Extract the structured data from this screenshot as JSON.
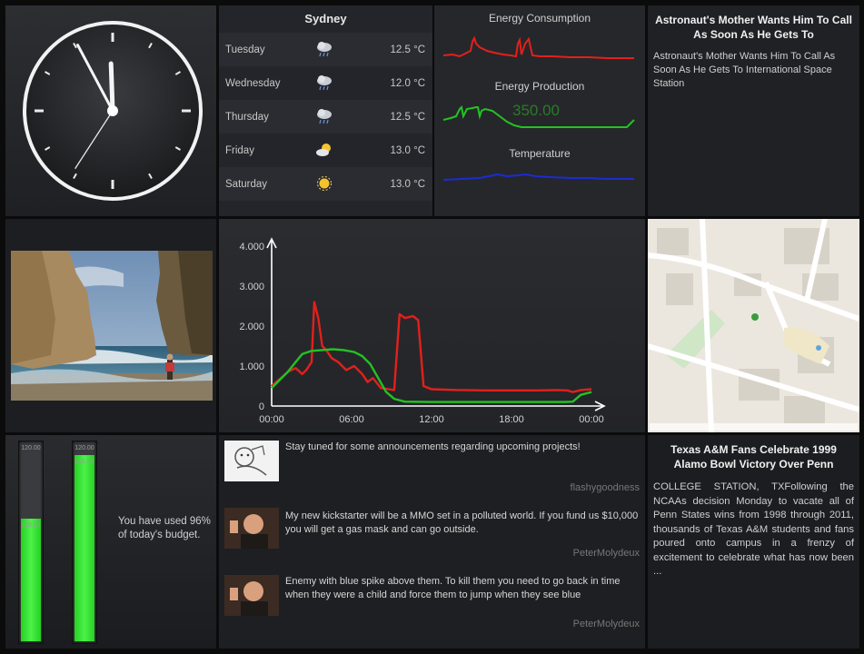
{
  "clock": {
    "hour_hand_deg": 358,
    "minute_hand_deg": 332,
    "second_hand_deg": 213
  },
  "weather": {
    "city": "Sydney",
    "days": [
      {
        "day": "Tuesday",
        "icon": "rain-cloud-icon",
        "temp": "12.5 °C"
      },
      {
        "day": "Wednesday",
        "icon": "rain-cloud-icon",
        "temp": "12.0 °C"
      },
      {
        "day": "Thursday",
        "icon": "rain-cloud-icon",
        "temp": "12.5 °C"
      },
      {
        "day": "Friday",
        "icon": "partly-sunny-icon",
        "temp": "13.0 °C"
      },
      {
        "day": "Saturday",
        "icon": "sun-icon",
        "temp": "13.0 °C"
      }
    ]
  },
  "energy": {
    "consumption": {
      "title": "Energy Consumption",
      "value": "",
      "color": "#e3201b"
    },
    "production": {
      "title": "Energy Production",
      "value": "350.00",
      "color": "#22c322"
    },
    "temperature": {
      "title": "Temperature",
      "color": "#1c2bd6"
    }
  },
  "news_top": {
    "headline": "Astronaut's Mother Wants Him To Call As Soon As He Gets To",
    "body": "Astronaut's Mother Wants Him To Call As Soon As He Gets To International Space Station"
  },
  "chart_data": {
    "type": "line",
    "y_ticks": [
      "4.000",
      "3.000",
      "2.000",
      "1.000",
      "0"
    ],
    "ylim": [
      0,
      4000
    ],
    "x_ticks": [
      "00:00",
      "06:00",
      "12:00",
      "18:00",
      "00:00"
    ],
    "x_hours": [
      0,
      24
    ],
    "series": [
      {
        "color": "#e3201b",
        "points": [
          [
            0,
            500
          ],
          [
            0.7,
            700
          ],
          [
            1.2,
            850
          ],
          [
            1.8,
            950
          ],
          [
            2.3,
            800
          ],
          [
            2.6,
            900
          ],
          [
            3.0,
            1100
          ],
          [
            3.2,
            2600
          ],
          [
            3.5,
            2200
          ],
          [
            3.8,
            1500
          ],
          [
            4.1,
            1400
          ],
          [
            4.5,
            1200
          ],
          [
            5.0,
            1100
          ],
          [
            5.6,
            900
          ],
          [
            6.2,
            1000
          ],
          [
            6.8,
            800
          ],
          [
            7.2,
            600
          ],
          [
            7.6,
            700
          ],
          [
            8.2,
            450
          ],
          [
            8.8,
            420
          ],
          [
            9.2,
            400
          ],
          [
            9.6,
            2300
          ],
          [
            10.0,
            2200
          ],
          [
            10.6,
            2250
          ],
          [
            11.0,
            2150
          ],
          [
            11.4,
            500
          ],
          [
            12.0,
            420
          ],
          [
            14.0,
            400
          ],
          [
            16.0,
            390
          ],
          [
            18.0,
            390
          ],
          [
            20.0,
            390
          ],
          [
            21.5,
            400
          ],
          [
            22.2,
            390
          ],
          [
            22.6,
            350
          ],
          [
            23.2,
            400
          ],
          [
            24.0,
            420
          ]
        ]
      },
      {
        "color": "#22c322",
        "points": [
          [
            0,
            450
          ],
          [
            0.6,
            650
          ],
          [
            1.2,
            850
          ],
          [
            1.8,
            1100
          ],
          [
            2.3,
            1300
          ],
          [
            3.0,
            1380
          ],
          [
            3.8,
            1400
          ],
          [
            4.6,
            1420
          ],
          [
            5.4,
            1400
          ],
          [
            6.2,
            1350
          ],
          [
            6.8,
            1250
          ],
          [
            7.4,
            1050
          ],
          [
            8.0,
            700
          ],
          [
            8.6,
            350
          ],
          [
            9.2,
            180
          ],
          [
            10.0,
            110
          ],
          [
            12.0,
            100
          ],
          [
            16.0,
            100
          ],
          [
            20.0,
            100
          ],
          [
            22.0,
            100
          ],
          [
            22.6,
            110
          ],
          [
            23.2,
            280
          ],
          [
            24.0,
            350
          ]
        ]
      }
    ]
  },
  "budget": {
    "bars": [
      {
        "top_label": "120.00",
        "mid_label": "115.00",
        "level": 0.62
      },
      {
        "top_label": "120.00",
        "mid_label": "115.00",
        "level": 0.94
      }
    ],
    "text": "You have used 96% of today's budget."
  },
  "tweets": [
    {
      "text": "Stay tuned for some announcements regarding upcoming projects!",
      "user": "flashygoodness"
    },
    {
      "text": "My new kickstarter will be a MMO set in a polluted world. If you fund us $10,000 you will get a gas mask and can go outside.",
      "user": "PeterMolydeux"
    },
    {
      "text": "Enemy with blue spike above them. To kill them you need to go back in time when they were a child and force them to jump when they see blue",
      "user": "PeterMolydeux"
    }
  ],
  "news_bottom": {
    "headline": "Texas A&M Fans Celebrate 1999 Alamo Bowl Victory Over Penn",
    "body": "COLLEGE STATION, TXFollowing the NCAAs decision Monday to vacate all of Penn States wins from 1998 through 2011, thousands of Texas A&M students and fans poured onto campus in a frenzy of excitement to celebrate what has now been ..."
  }
}
